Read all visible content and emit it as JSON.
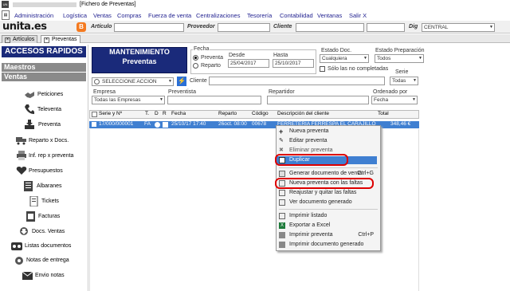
{
  "window": {
    "title": "[Fichero de Preventas]",
    "icon": "app-icon"
  },
  "menu": [
    "Administración",
    "Logística",
    "Ventas",
    "Compras",
    "Fuerza de venta",
    "Centralizaciones",
    "Tesorería",
    "Contabilidad",
    "Ventanas",
    "Salir X"
  ],
  "toolbar": {
    "logo": "unita.es",
    "logo_badge": "blogger-icon",
    "articulo_label": "Artículo",
    "proveedor_label": "Proveedor",
    "cliente_label": "Cliente",
    "dig_label": "Dig",
    "central_value": "CENTRAL"
  },
  "tabs": [
    {
      "label": "Artículos",
      "active": false
    },
    {
      "label": "Preventas",
      "active": true
    }
  ],
  "sidebar": {
    "header": "ACCESOS RAPIDOS",
    "sections": [
      "Maestros",
      "Ventas"
    ],
    "items": [
      {
        "label": "Peticiones",
        "icon": "handshake-icon"
      },
      {
        "label": "Televenta",
        "icon": "phone-icon"
      },
      {
        "label": "Preventa",
        "icon": "download-icon"
      },
      {
        "label": "Reparto x Docs.",
        "icon": "truck-icon"
      },
      {
        "label": "Inf. rep x preventa",
        "icon": "printer-icon"
      },
      {
        "label": "Presupuestos",
        "icon": "heart-icon"
      },
      {
        "label": "Albaranes",
        "icon": "document-icon"
      },
      {
        "label": "Tickets",
        "icon": "receipt-icon"
      },
      {
        "label": "Facturas",
        "icon": "invoice-icon"
      },
      {
        "label": "Docs. Ventas",
        "icon": "download-doc-icon"
      },
      {
        "label": "Listas documentos",
        "icon": "cassette-icon"
      },
      {
        "label": "Notas de entrega",
        "icon": "gear-icon"
      },
      {
        "label": "Envio notas",
        "icon": "envelope-icon"
      }
    ]
  },
  "panel": {
    "title_line1": "MANTENIMIENTO",
    "title_line2": "Preventas",
    "fecha_group": "Fecha",
    "radio_preventa": "Preventa",
    "radio_reparto": "Reparto",
    "desde_label": "Desde",
    "desde_value": "25/04/2017",
    "hasta_label": "Hasta",
    "hasta_value": "25/10/2017",
    "estado_doc_label": "Estado Doc.",
    "estado_doc_value": "Cualquiera",
    "solo_no_completadas": "Sólo las no completadas",
    "estado_prep_label": "Estado Preparación",
    "estado_prep_value": "Todos",
    "serie_label": "Serie",
    "serie_value": "Todas",
    "accion_value": "SELECCIONE ACCION",
    "cliente_label": "Cliente",
    "empresa_label": "Empresa",
    "empresa_value": "Todas las Empresas",
    "preventista_label": "Preventista",
    "repartidor_label": "Repartidor",
    "ordenado_label": "Ordenado por",
    "ordenado_value": "Fecha"
  },
  "grid": {
    "columns": [
      "Serie y Nº",
      "T.",
      "D",
      "R",
      "Fecha",
      "Reparto",
      "Código",
      "Descripción del cliente",
      "Total"
    ],
    "row": {
      "serie": "17/000/000001",
      "t": "FA",
      "fecha": "25/10/17 17:40",
      "reparto": "26oct. 08:00",
      "codigo": "00678",
      "descripcion": "FERRETERIA FERRESPA EL CARAJILLO",
      "total": "348,46 €"
    }
  },
  "context_menu": {
    "items": [
      {
        "label": "Nueva preventa",
        "icon": "plus-icon",
        "shortcut": ""
      },
      {
        "label": "Editar preventa",
        "icon": "edit-icon",
        "shortcut": ""
      },
      {
        "label": "Eliminar preventa",
        "icon": "delete-icon",
        "shortcut": ""
      },
      {
        "label": "Duplicar",
        "icon": "duplicate-icon",
        "shortcut": ""
      },
      {
        "label": "Generar documento de venta",
        "icon": "generate-icon",
        "shortcut": "Ctrl+G"
      },
      {
        "label": "Nueva preventa con las faltas",
        "icon": "missing-icon",
        "shortcut": ""
      },
      {
        "label": "Reajustar y quitar las faltas",
        "icon": "adjust-icon",
        "shortcut": ""
      },
      {
        "label": "Ver documento generado",
        "icon": "view-icon",
        "shortcut": ""
      },
      {
        "label": "Imprimir listado",
        "icon": "list-icon",
        "shortcut": ""
      },
      {
        "label": "Exportar a Excel",
        "icon": "excel-icon",
        "shortcut": ""
      },
      {
        "label": "Imprimir preventa",
        "icon": "print-icon",
        "shortcut": "Ctrl+P"
      },
      {
        "label": "Imprimir documento generado",
        "icon": "print-doc-icon",
        "shortcut": ""
      }
    ]
  },
  "colors": {
    "header_blue": "#1a2a7a",
    "selection": "#3f7fd1",
    "highlight_ring": "#dd0000"
  }
}
